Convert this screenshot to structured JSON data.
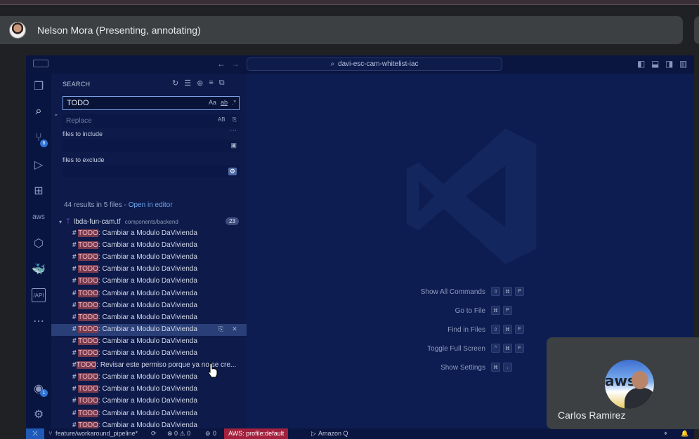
{
  "meeting": {
    "presenter_name": "Nelson Mora (Presenting, annotating)",
    "participant_name": "Carlos Ramirez"
  },
  "titlebar": {
    "back_icon": "arrow-left-icon",
    "forward_icon": "arrow-right-icon",
    "search_text": "davi-esc-cam-whitelist-iac"
  },
  "activity_bar": {
    "scm_badge": "6",
    "accounts_badge": "1"
  },
  "search": {
    "title": "SEARCH",
    "query": "TODO",
    "opt_case": "Aa",
    "opt_word": "ab",
    "opt_regex": ".*",
    "replace_placeholder": "Replace",
    "replace_preserve": "AB",
    "files_include_label": "files to include",
    "files_exclude_label": "files to exclude",
    "results_summary": "44 results in 5 files - ",
    "open_in_editor": "Open in editor",
    "file": {
      "name": "lbda-fun-cam.tf",
      "path": "components/backend",
      "count": "23"
    },
    "results": [
      {
        "prefix": "# ",
        "match": "TODO",
        "rest": ": Cambiar a Modulo DaVivienda"
      },
      {
        "prefix": "# ",
        "match": "TODO",
        "rest": ": Cambiar a Modulo DaVivienda"
      },
      {
        "prefix": "# ",
        "match": "TODO",
        "rest": ": Cambiar a Modulo DaVivienda"
      },
      {
        "prefix": "# ",
        "match": "TODO",
        "rest": ": Cambiar a Modulo DaVivienda"
      },
      {
        "prefix": "# ",
        "match": "TODO",
        "rest": ": Cambiar a Modulo DaVivienda"
      },
      {
        "prefix": "# ",
        "match": "TODO",
        "rest": ": Cambiar a Modulo DaVivienda"
      },
      {
        "prefix": "# ",
        "match": "TODO",
        "rest": ": Cambiar a Modulo DaVivienda"
      },
      {
        "prefix": "# ",
        "match": "TODO",
        "rest": ": Cambiar a Modulo DaVivienda"
      },
      {
        "prefix": "# ",
        "match": "TODO",
        "rest": ": Cambiar a Modulo DaVivienda"
      },
      {
        "prefix": "# ",
        "match": "TODO",
        "rest": ": Cambiar a Modulo DaVivienda"
      },
      {
        "prefix": "# ",
        "match": "TODO",
        "rest": ": Cambiar a Modulo DaVivienda"
      },
      {
        "prefix": "#",
        "match": "TODO",
        "rest": ": Revisar este permiso porque ya no se cre..."
      },
      {
        "prefix": "# ",
        "match": "TODO",
        "rest": ": Cambiar a Modulo DaVivienda"
      },
      {
        "prefix": "# ",
        "match": "TODO",
        "rest": ": Cambiar a Modulo DaVivienda"
      },
      {
        "prefix": "# ",
        "match": "TODO",
        "rest": ": Cambiar a Modulo DaVivienda"
      },
      {
        "prefix": "# ",
        "match": "TODO",
        "rest": ": Cambiar a Modulo DaVivienda"
      },
      {
        "prefix": "# ",
        "match": "TODO",
        "rest": ": Cambiar a Modulo DaVivienda"
      }
    ]
  },
  "editor": {
    "shortcuts": [
      {
        "label": "Show All Commands",
        "keys": [
          "⇧",
          "⌘",
          "P"
        ]
      },
      {
        "label": "Go to File",
        "keys": [
          "⌘",
          "P"
        ]
      },
      {
        "label": "Find in Files",
        "keys": [
          "⇧",
          "⌘",
          "F"
        ]
      },
      {
        "label": "Toggle Full Screen",
        "keys": [
          "^",
          "⌘",
          "F"
        ]
      },
      {
        "label": "Show Settings",
        "keys": [
          "⌘",
          ","
        ]
      }
    ]
  },
  "statusbar": {
    "branch": "feature/workaround_pipeline*",
    "problems": "⊗ 0 ⚠ 0",
    "ports": "0",
    "aws_profile": "AWS: profile:default",
    "amazon_q": "Amazon Q"
  },
  "colors": {
    "match_highlight": "#7a3b4e",
    "accent": "#2f74d6",
    "aws_status": "#a3213d"
  }
}
